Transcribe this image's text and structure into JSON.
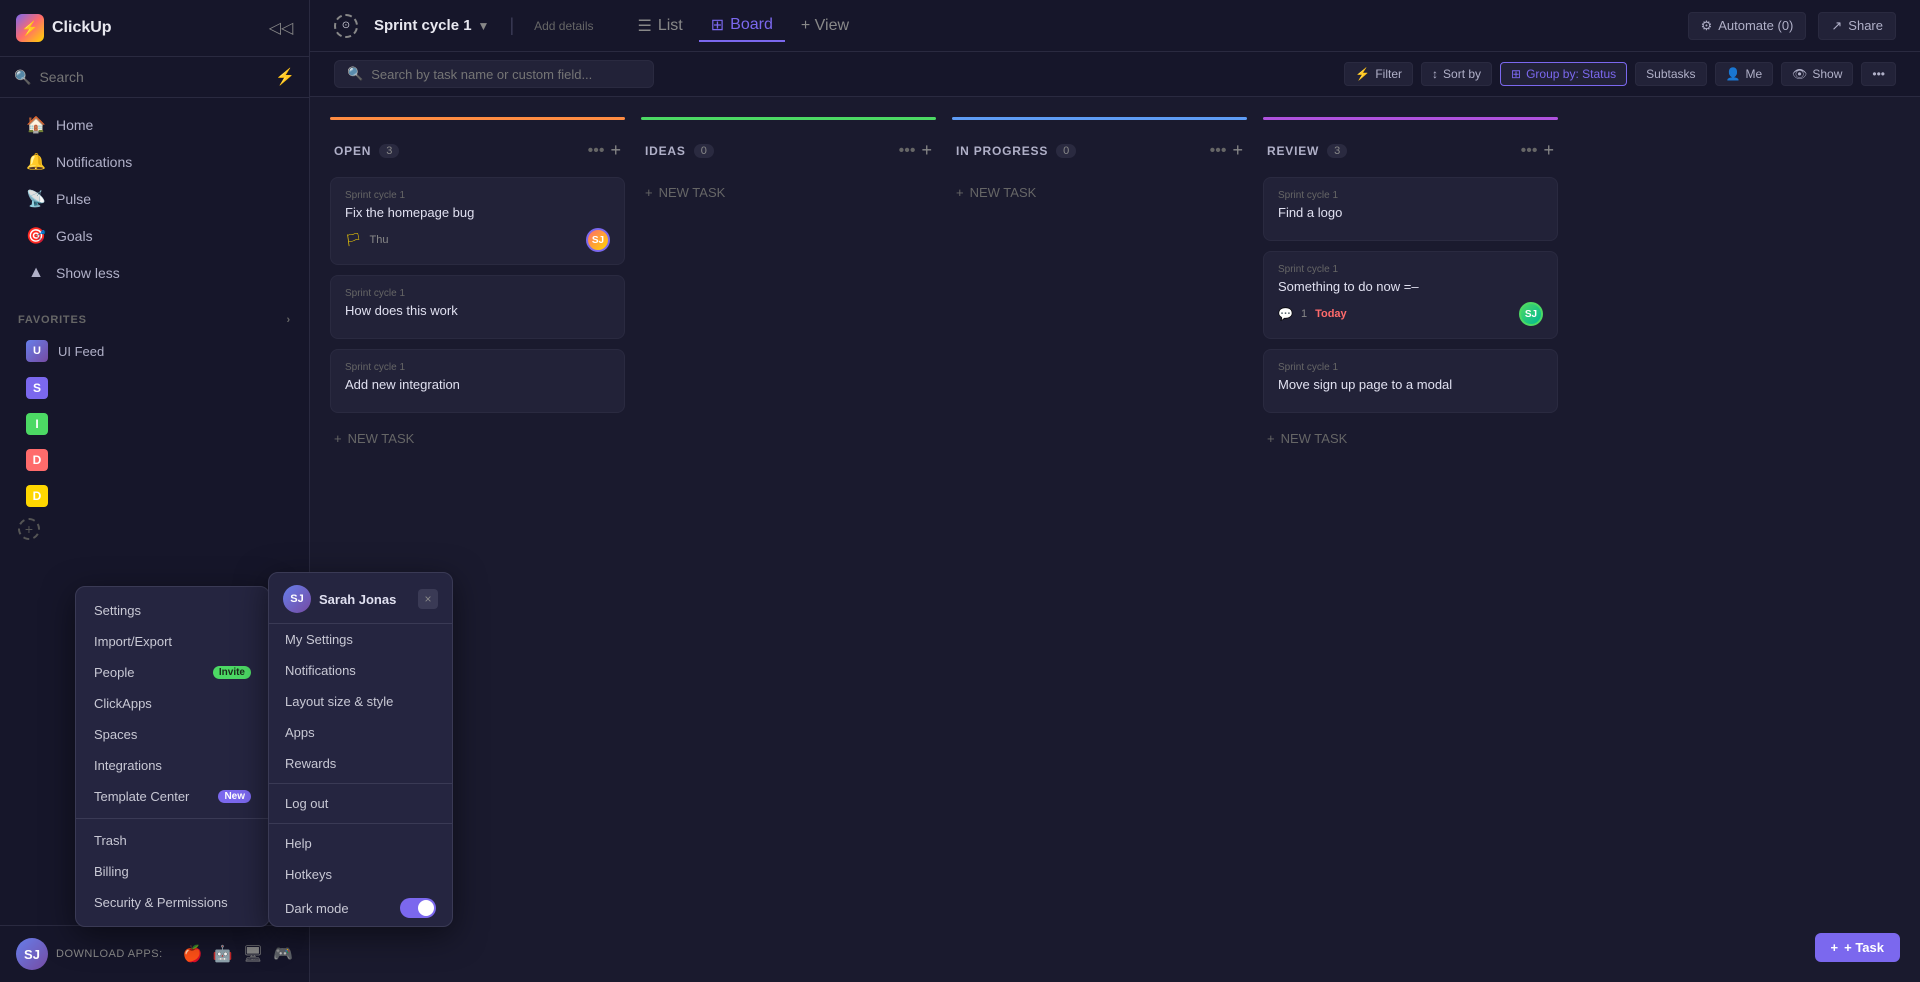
{
  "app": {
    "name": "ClickUp",
    "logo_emoji": "⚡"
  },
  "sidebar": {
    "search_placeholder": "Search",
    "nav_items": [
      {
        "label": "Home",
        "icon": "🏠",
        "id": "home"
      },
      {
        "label": "Notifications",
        "icon": "🔔",
        "id": "notifications"
      },
      {
        "label": "Pulse",
        "icon": "📡",
        "id": "pulse"
      },
      {
        "label": "Goals",
        "icon": "🎯",
        "id": "goals"
      },
      {
        "label": "Show less",
        "icon": "▲",
        "id": "show-less"
      }
    ],
    "favorites_label": "FAVORITES",
    "favorite_items": [
      {
        "label": "UI Feed",
        "initials": "U",
        "color": "#667eea"
      }
    ],
    "section_items": [
      {
        "letter": "S",
        "color": "#7b68ee"
      },
      {
        "letter": "I",
        "color": "#4cd964"
      },
      {
        "letter": "D",
        "color": "#ff6b6b"
      },
      {
        "letter": "D",
        "color": "#ffd700"
      }
    ],
    "download_apps_label": "DOWNLOAD APPS:",
    "user_initials": "SJ"
  },
  "topbar": {
    "sprint_icon": "⊙",
    "sprint_title": "Sprint cycle 1",
    "add_details": "Add details",
    "tabs": [
      {
        "label": "List",
        "id": "list",
        "active": false
      },
      {
        "label": "Board",
        "id": "board",
        "active": true
      },
      {
        "label": "+ View",
        "id": "add-view",
        "active": false
      }
    ],
    "automate_label": "Automate (0)",
    "share_label": "Share"
  },
  "filter_bar": {
    "search_placeholder": "Search by task name or custom field...",
    "filter_label": "Filter",
    "sort_by_label": "Sort by",
    "group_by_label": "Group by: Status",
    "subtasks_label": "Subtasks",
    "me_label": "Me",
    "show_label": "Show"
  },
  "board": {
    "columns": [
      {
        "id": "open",
        "title": "OPEN",
        "count": 3,
        "color_class": "col-open",
        "cards": [
          {
            "sprint": "Sprint cycle 1",
            "title": "Fix the homepage bug",
            "flag": true,
            "date": "Thu",
            "avatar": true,
            "avatar_initials": "SJ"
          },
          {
            "sprint": "Sprint cycle 1",
            "title": "How does this work",
            "flag": false,
            "date": "",
            "avatar": false,
            "avatar_initials": ""
          },
          {
            "sprint": "Sprint cycle 1",
            "title": "Add new integration",
            "flag": false,
            "date": "",
            "avatar": false,
            "avatar_initials": ""
          }
        ],
        "new_task_label": "+ NEW TASK"
      },
      {
        "id": "ideas",
        "title": "IDEAS",
        "count": 0,
        "color_class": "col-ideas",
        "cards": [],
        "new_task_label": "+ NEW TASK"
      },
      {
        "id": "inprogress",
        "title": "IN PROGRESS",
        "count": 0,
        "color_class": "col-inprogress",
        "cards": [],
        "new_task_label": "+ NEW TASK"
      },
      {
        "id": "review",
        "title": "REVIEW",
        "count": 3,
        "color_class": "col-review",
        "cards": [
          {
            "sprint": "Sprint cycle 1",
            "title": "Find a logo",
            "flag": false,
            "date": "",
            "avatar": false,
            "avatar_initials": ""
          },
          {
            "sprint": "Sprint cycle 1",
            "title": "Something to do now",
            "flag": false,
            "date": "",
            "avatar": true,
            "avatar_initials": "SJ",
            "comment_count": "1",
            "today": "Today"
          },
          {
            "sprint": "Sprint cycle 1",
            "title": "Move sign up page to a modal",
            "flag": false,
            "date": "",
            "avatar": false,
            "avatar_initials": ""
          }
        ],
        "new_task_label": "+ NEW TASK"
      }
    ]
  },
  "dropdown_menu": {
    "items": [
      {
        "label": "Settings",
        "badge": null,
        "id": "settings"
      },
      {
        "label": "Import/Export",
        "badge": null,
        "id": "import-export"
      },
      {
        "label": "People",
        "badge": "Invite",
        "badge_type": "invite",
        "id": "people"
      },
      {
        "label": "ClickApps",
        "badge": null,
        "id": "clickapps"
      },
      {
        "label": "Spaces",
        "badge": null,
        "id": "spaces"
      },
      {
        "label": "Integrations",
        "badge": null,
        "id": "integrations"
      },
      {
        "label": "Template Center",
        "badge": "New",
        "badge_type": "new",
        "id": "template-center"
      },
      {
        "label": "Trash",
        "badge": null,
        "id": "trash"
      },
      {
        "label": "Billing",
        "badge": null,
        "id": "billing"
      },
      {
        "label": "Security & Permissions",
        "badge": null,
        "id": "security"
      }
    ]
  },
  "user_dropdown": {
    "user_name": "Sarah Jonas",
    "user_initials": "SJ",
    "items": [
      {
        "label": "My Settings",
        "id": "my-settings",
        "toggle": false
      },
      {
        "label": "Notifications",
        "id": "notifications-ud",
        "toggle": false
      },
      {
        "label": "Layout size & style",
        "id": "layout",
        "toggle": false
      },
      {
        "label": "Apps",
        "id": "apps",
        "toggle": false
      },
      {
        "label": "Rewards",
        "id": "rewards",
        "toggle": false
      },
      {
        "label": "Log out",
        "id": "logout",
        "toggle": false,
        "divider_before": true
      },
      {
        "label": "Help",
        "id": "help",
        "toggle": false
      },
      {
        "label": "Hotkeys",
        "id": "hotkeys",
        "toggle": false
      },
      {
        "label": "Dark mode",
        "id": "dark-mode",
        "toggle": true
      }
    ],
    "close_label": "×"
  },
  "notifications_badge": {
    "label": "Notifications",
    "id": "notifications-sidebar"
  },
  "floating_task_btn": {
    "label": "+ Task"
  }
}
